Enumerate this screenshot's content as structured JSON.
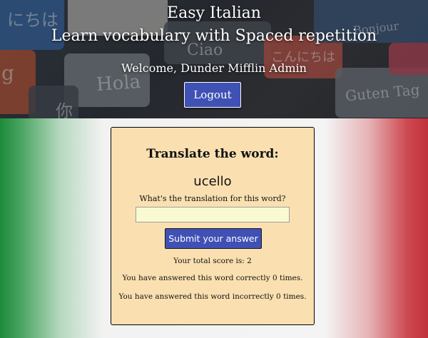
{
  "header": {
    "title_line1": "Easy Italian",
    "title_line2": "Learn vocabulary with Spaced repetition",
    "welcome": "Welcome, Dunder Mifflin Admin",
    "logout_label": "Logout",
    "background_words": [
      "にちは",
      "Bonjour",
      "Hola",
      "Guten Tag",
      "你",
      "Ciao",
      "こんにちは",
      "g"
    ]
  },
  "card": {
    "heading": "Translate the word:",
    "word": "ucello",
    "prompt": "What's the translation for this word?",
    "answer_value": "",
    "answer_placeholder": "",
    "submit_label": "Submit your answer",
    "score_text": "Your total score is: 2",
    "correct_text": "You have answered this word correctly 0 times.",
    "incorrect_text": "You have answered this word incorrectly 0 times."
  },
  "colors": {
    "flag_green": "#1e8a3a",
    "flag_white": "#f4f4f4",
    "flag_red": "#c0303a",
    "card_background": "#fae0b0",
    "button_blue": "#3f51b5",
    "input_background": "#fafad2"
  }
}
